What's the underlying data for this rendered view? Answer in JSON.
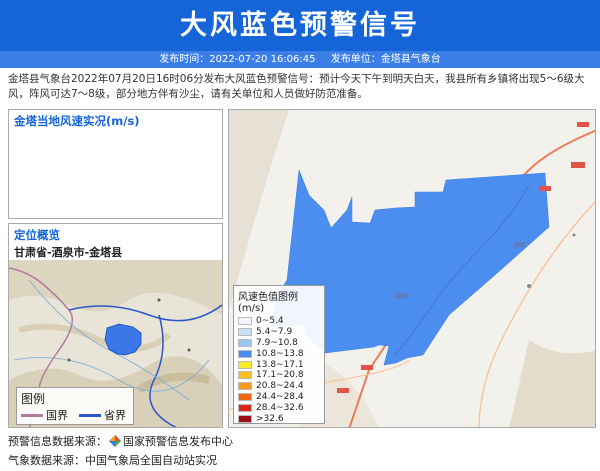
{
  "header": {
    "title": "大风蓝色预警信号"
  },
  "subbar": {
    "time_label": "发布时间：2022-07-20 16:06:45",
    "unit_label": "发布单位：金塔县气象台"
  },
  "description": "金塔县气象台2022年07月20日16时06分发布大风蓝色预警信号：预计今天下午到明天白天，我县所有乡镇将出现5～6级大风，阵风可达7～8级，部分地方伴有沙尘，请有关单位和人员做好防范准备。",
  "wind_panel": {
    "title": "金塔当地风速实况(m/s)"
  },
  "location_panel": {
    "title": "定位概览",
    "subtitle": "甘肃省-酒泉市-金塔县",
    "legend": {
      "title": "图例",
      "items": [
        {
          "label": "国界",
          "color": "#b07a9a"
        },
        {
          "label": "省界",
          "color": "#2b58c9"
        }
      ]
    }
  },
  "wind_legend": {
    "title": "风速色值图例 (m/s)",
    "items": [
      {
        "label": "0~5.4",
        "color": "#f2f5fb"
      },
      {
        "label": "5.4~7.9",
        "color": "#c9def7"
      },
      {
        "label": "7.9~10.8",
        "color": "#9cc7f3"
      },
      {
        "label": "10.8~13.8",
        "color": "#4c8ef0"
      },
      {
        "label": "13.8~17.1",
        "color": "#f7ee25"
      },
      {
        "label": "17.1~20.8",
        "color": "#f9c21f"
      },
      {
        "label": "20.8~24.4",
        "color": "#f79a1c"
      },
      {
        "label": "24.4~28.4",
        "color": "#f06416"
      },
      {
        "label": "28.4~32.6",
        "color": "#d9271b"
      },
      {
        "label": ">32.6",
        "color": "#9e0d14"
      }
    ]
  },
  "map": {
    "warning_area_color": "#4c8ef0",
    "road_color": "#f07a56"
  },
  "footer": {
    "warning_source": "预警信息数据来源：",
    "warning_source_name": "国家预警信息发布中心",
    "weather_source": "气象数据来源：中国气象局全国自动站实况"
  }
}
